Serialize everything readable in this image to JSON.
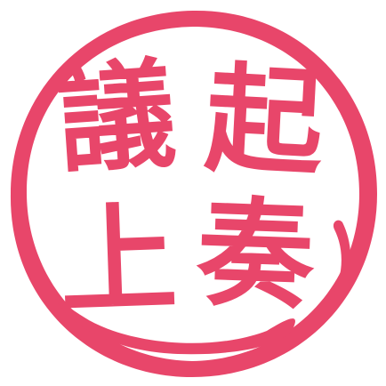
{
  "seal": {
    "characters": {
      "top_left": "議",
      "top_right": "起",
      "bottom_left": "上",
      "bottom_right": "奏"
    },
    "color": "#e8466a",
    "background": "#ffffff"
  }
}
